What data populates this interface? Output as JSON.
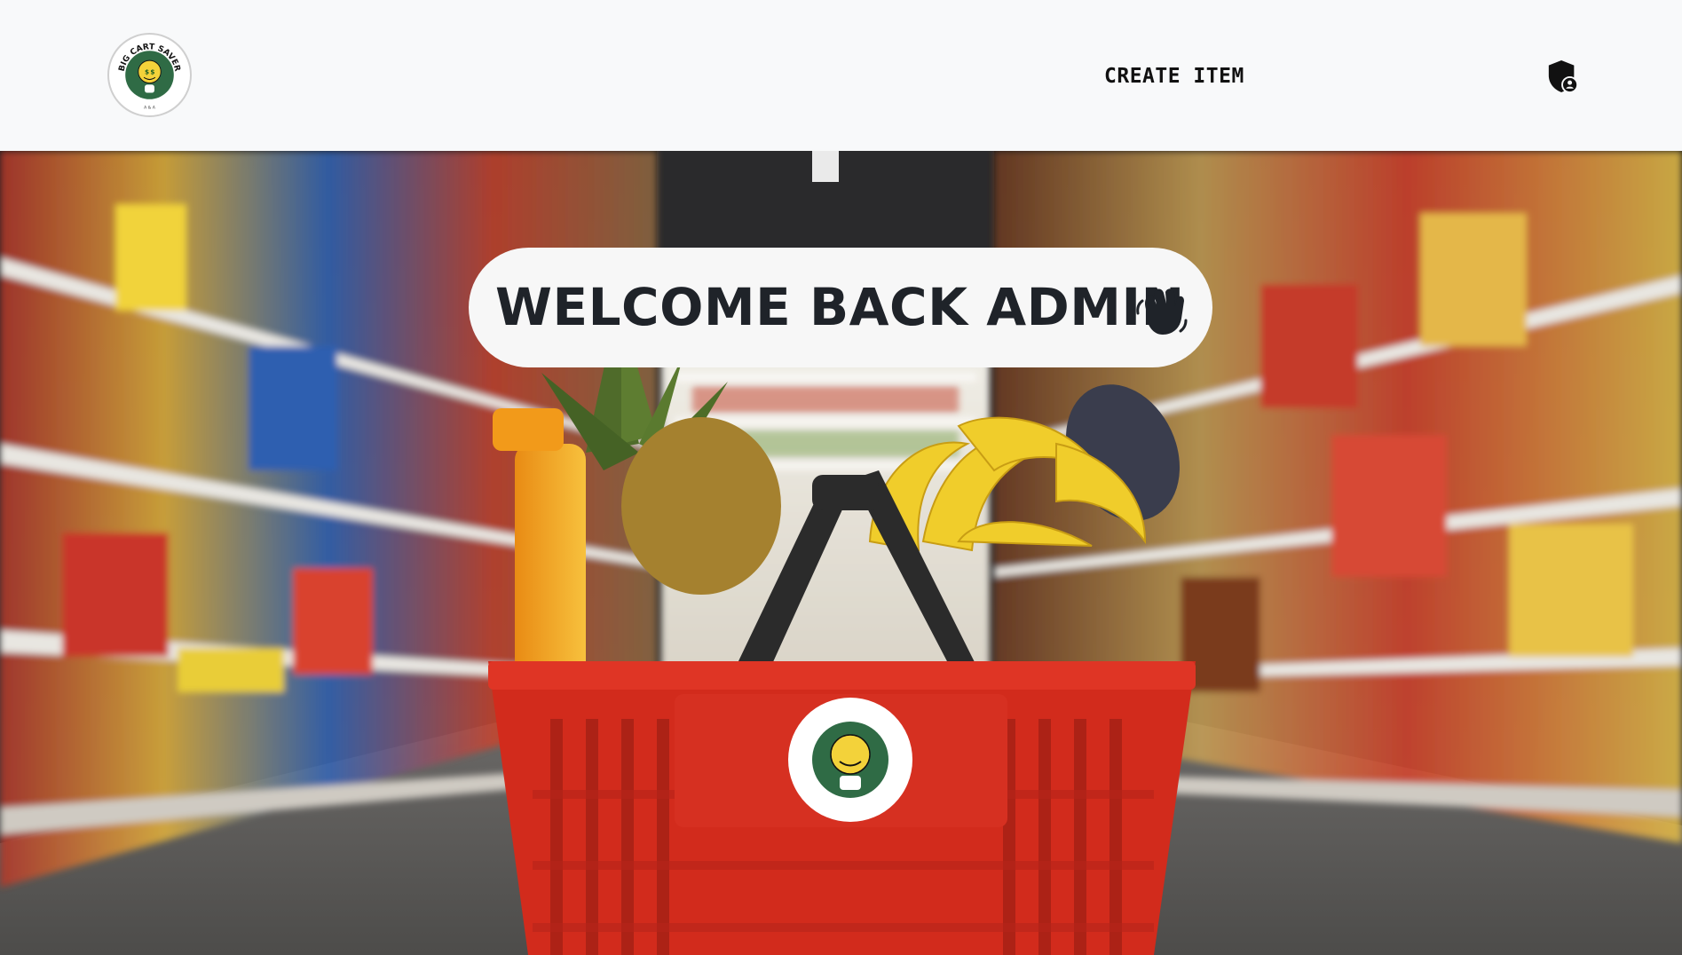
{
  "header": {
    "logo": {
      "name": "big-cart-saver-logo",
      "brand_text": "BIG CART SAVER",
      "sub_text": "A & A"
    },
    "nav_links": [
      {
        "label": "CREATE ITEM"
      }
    ],
    "admin_icon": "shield-user-icon"
  },
  "hero": {
    "background_image": "grocery-aisle-basket-photo",
    "welcome_text": "WELCOME BACK ADMIN",
    "welcome_icon": "waving-hand-icon"
  },
  "colors": {
    "navbar_bg": "#f8f9fa",
    "text_dark": "#111111",
    "pill_bg": "#f7f7f7",
    "logo_green": "#2f6b45",
    "logo_yellow": "#f3d23a",
    "basket_red": "#d22b1c"
  }
}
